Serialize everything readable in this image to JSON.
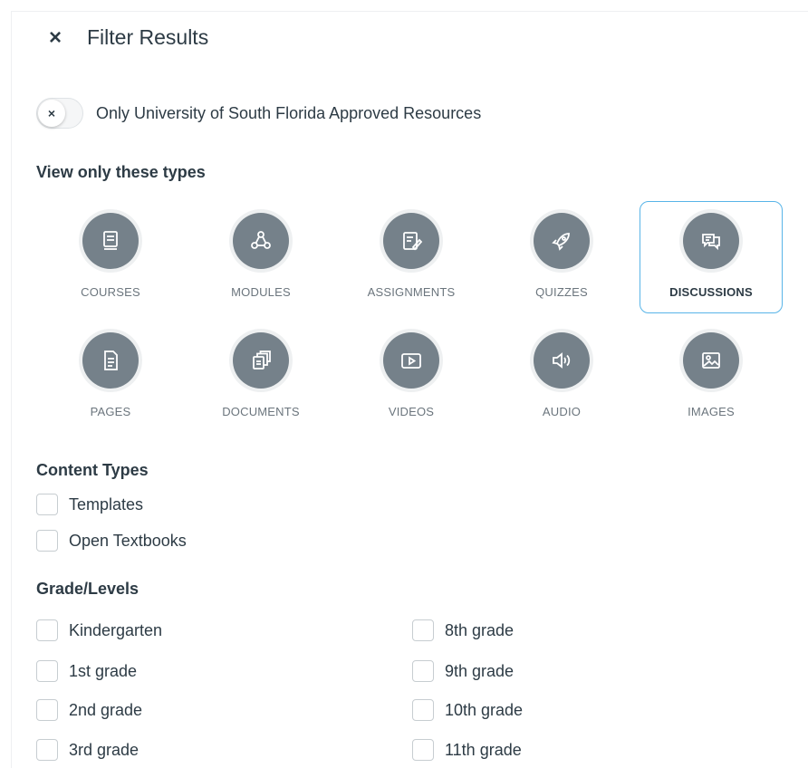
{
  "header": {
    "close_icon": "×",
    "title": "Filter Results"
  },
  "approved_toggle": {
    "knob_icon": "×",
    "label": "Only University of South Florida Approved Resources",
    "on": false
  },
  "types_section": {
    "title": "View only these types",
    "types": [
      {
        "label": "COURSES",
        "icon": "course-icon",
        "selected": false
      },
      {
        "label": "MODULES",
        "icon": "modules-icon",
        "selected": false
      },
      {
        "label": "ASSIGNMENTS",
        "icon": "assignment-icon",
        "selected": false
      },
      {
        "label": "QUIZZES",
        "icon": "quiz-rocket-icon",
        "selected": false
      },
      {
        "label": "DISCUSSIONS",
        "icon": "discussion-icon",
        "selected": true
      },
      {
        "label": "PAGES",
        "icon": "page-icon",
        "selected": false
      },
      {
        "label": "DOCUMENTS",
        "icon": "documents-icon",
        "selected": false
      },
      {
        "label": "VIDEOS",
        "icon": "video-icon",
        "selected": false
      },
      {
        "label": "AUDIO",
        "icon": "audio-icon",
        "selected": false
      },
      {
        "label": "IMAGES",
        "icon": "image-icon",
        "selected": false
      }
    ]
  },
  "content_types": {
    "title": "Content Types",
    "options": [
      {
        "label": "Templates",
        "checked": false
      },
      {
        "label": "Open Textbooks",
        "checked": false
      }
    ]
  },
  "grade_levels": {
    "title": "Grade/Levels",
    "options": [
      {
        "label": "Kindergarten",
        "checked": false
      },
      {
        "label": "1st grade",
        "checked": false
      },
      {
        "label": "2nd grade",
        "checked": false
      },
      {
        "label": "3rd grade",
        "checked": false
      },
      {
        "label": "8th grade",
        "checked": false
      },
      {
        "label": "9th grade",
        "checked": false
      },
      {
        "label": "10th grade",
        "checked": false
      },
      {
        "label": "11th grade",
        "checked": false
      }
    ]
  },
  "colors": {
    "accent": "#58b4e8",
    "icon_bg": "#75818a",
    "text": "#2d3b45"
  }
}
